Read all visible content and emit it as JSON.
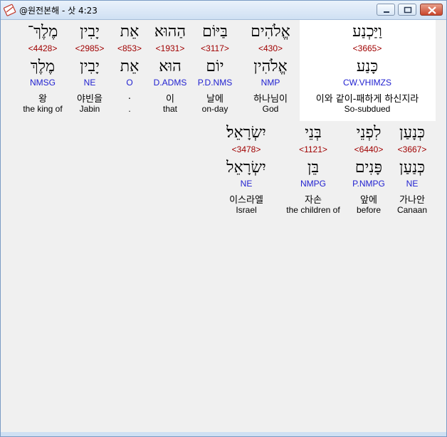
{
  "window": {
    "title": "@원전본해 - 삿 4:23"
  },
  "rows": [
    [
      {
        "heb": "וַיַּכְנַע",
        "strong": "<3665>",
        "lex": "כָּנַע",
        "parse": "CW.VHIMZS",
        "kor": "이와 같이-패하게 하신지라",
        "eng": "So-subdued"
      },
      {
        "heb": "אֱלֹהִים",
        "strong": "<430>",
        "lex": "אֱלֹהִין",
        "parse": "NMP",
        "kor": "하나님이",
        "eng": "God"
      },
      {
        "heb": "בַּיּוֹם",
        "strong": "<3117>",
        "lex": "יוֹם",
        "parse": "P.D.NMS",
        "kor": "날에",
        "eng": "on-day"
      },
      {
        "heb": "הַהוּא",
        "strong": "<1931>",
        "lex": "הוּא",
        "parse": "D.ADMS",
        "kor": "이",
        "eng": "that"
      },
      {
        "heb": "אֵת",
        "strong": "<853>",
        "lex": "אֵת",
        "parse": "O",
        "kor": ".",
        "eng": "."
      },
      {
        "heb": "יָבִין",
        "strong": "<2985>",
        "lex": "יָבִין",
        "parse": "NE",
        "kor": "야빈을",
        "eng": "Jabin"
      },
      {
        "heb": "מֶלֶךְ־",
        "strong": "<4428>",
        "lex": "מֶלֶךְ",
        "parse": "NMSG",
        "kor": "왕",
        "eng": "the king of"
      }
    ],
    [
      {
        "heb": "כְּנָעַן",
        "strong": "<3667>",
        "lex": "כְּנַעַן",
        "parse": "NE",
        "kor": "가나안",
        "eng": "Canaan"
      },
      {
        "heb": "לִפְנֵי",
        "strong": "<6440>",
        "lex": "פָּנִים",
        "parse": "P.NMPG",
        "kor": "앞에",
        "eng": "before"
      },
      {
        "heb": "בְּנֵי",
        "strong": "<1121>",
        "lex": "בֵּן",
        "parse": "NMPG",
        "kor": "자손",
        "eng": "the children of"
      },
      {
        "heb": "יִשְׂרָאֵל׃",
        "strong": "<3478>",
        "lex": "יִשְׂרָאֵל",
        "parse": "NE",
        "kor": "이스라엘",
        "eng": "Israel"
      }
    ]
  ]
}
